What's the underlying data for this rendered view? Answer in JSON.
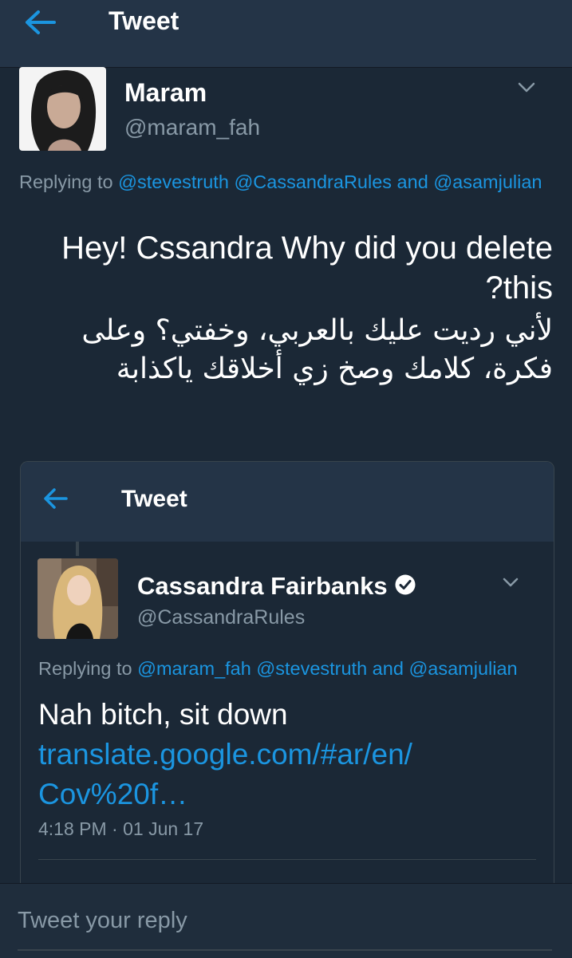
{
  "header": {
    "title": "Tweet"
  },
  "tweet": {
    "name": "Maram",
    "handle": "@maram_fah",
    "replying_prefix": "Replying to ",
    "replying_links": [
      "@stevestruth",
      "@CassandraRules"
    ],
    "replying_and": " and ",
    "replying_last": "@asamjulian",
    "text_en": "Hey! Cssandra Why did you delete this?",
    "text_ar": "لأني رديت عليك بالعربي، وخفتي؟ وعلى فكرة، كلامك وصخ زي أخلاقك ياكذابة"
  },
  "quoted": {
    "header_title": "Tweet",
    "name": "Cassandra Fairbanks",
    "handle": "@CassandraRules",
    "replying_prefix": "Replying to ",
    "replying_links": [
      "@maram_fah",
      "@stevestruth"
    ],
    "replying_and": " and ",
    "replying_last": "@asamjulian",
    "text": "Nah bitch, sit down",
    "link_line1": "translate.google.com/#ar/en/",
    "link_line2": "Cov%20f…",
    "timestamp": "4:18 PM · 01 Jun 17"
  },
  "reply": {
    "placeholder": "Tweet your reply"
  },
  "colors": {
    "background": "#1b2836",
    "bar": "#243447",
    "accent": "#1b95e0",
    "muted": "#8899a6",
    "divider": "#38444d"
  },
  "icons": {
    "back": "back-arrow-icon",
    "menu": "chevron-down-icon",
    "verified": "verified-badge-icon"
  }
}
